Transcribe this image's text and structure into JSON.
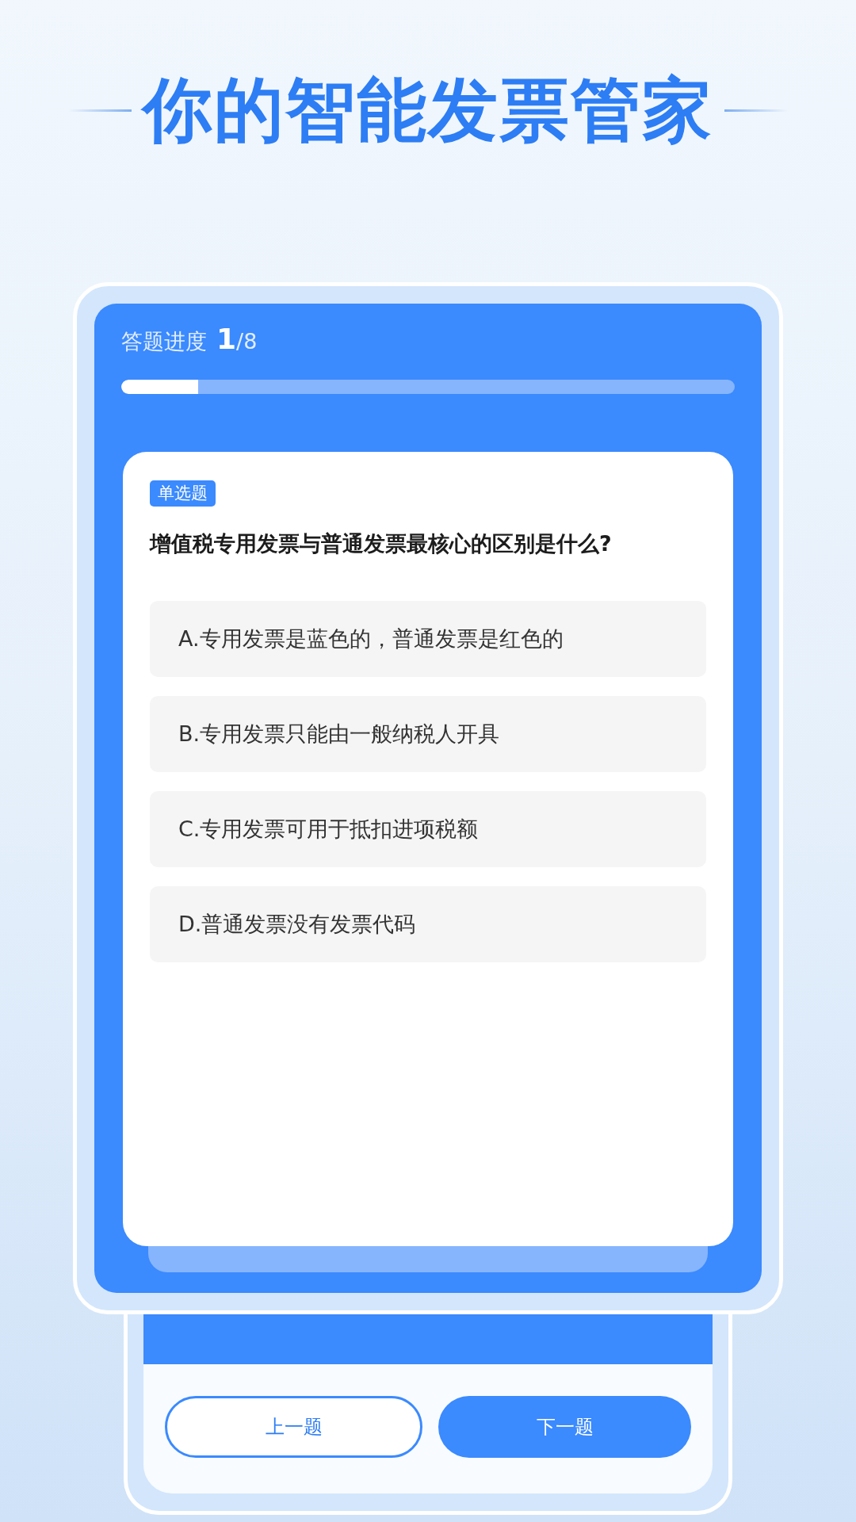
{
  "headline": "你的智能发票管家",
  "progress": {
    "label": "答题进度",
    "current": "1",
    "total": "/8",
    "level": 0.125
  },
  "question": {
    "tag": "单选题",
    "text": "增值税专用发票与普通发票最核心的区别是什么?",
    "options": [
      {
        "text": "A.专用发票是蓝色的，普通发票是红色的",
        "selected": false
      },
      {
        "text": "B.专用发票只能由一般纳税人开具",
        "selected": false
      },
      {
        "text": "C.专用发票可用于抵扣进项税额",
        "selected": false
      },
      {
        "text": "D.普通发票没有发票代码",
        "selected": false
      }
    ]
  },
  "buttons": [
    {
      "label": "上一题",
      "kind": "outline"
    },
    {
      "label": "下一题",
      "kind": "filled"
    }
  ]
}
